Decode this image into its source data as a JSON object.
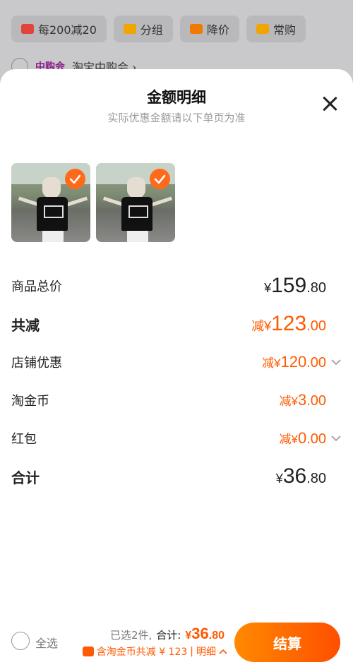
{
  "background": {
    "filters": [
      {
        "label": "每200减20",
        "icon": "shop-icon",
        "color": "#e0443a"
      },
      {
        "label": "分组",
        "icon": "folder-icon",
        "color": "#f0a500"
      },
      {
        "label": "降价",
        "icon": "down-arrow-icon",
        "color": "#f07a00"
      },
      {
        "label": "常购",
        "icon": "cart-icon",
        "color": "#f0a500"
      }
    ],
    "store_tag": "中购会",
    "store_name": "淘宝中购会 ›"
  },
  "sheet": {
    "title": "金额明细",
    "subtitle": "实际优惠金额请以下单页为准",
    "close_icon": "close-icon"
  },
  "items": [
    {
      "selected": true
    },
    {
      "selected": true
    }
  ],
  "breakdown": {
    "goods_total": {
      "label": "商品总价",
      "prefix": "¥",
      "int": "159",
      "dec": ".80"
    },
    "total_reduce": {
      "label": "共减",
      "prefix": "减¥",
      "int": "123",
      "dec": ".00"
    },
    "shop_discount": {
      "label": "店铺优惠",
      "prefix": "减¥",
      "int": "120",
      "dec": ".00"
    },
    "taojinbi": {
      "label": "淘金币",
      "prefix": "减¥",
      "int": "3",
      "dec": ".00"
    },
    "red_packet": {
      "label": "红包",
      "prefix": "减¥",
      "int": "0",
      "dec": ".00"
    },
    "sum": {
      "label": "合计",
      "prefix": "¥",
      "int": "36",
      "dec": ".80"
    }
  },
  "bottom_bar": {
    "select_all": "全选",
    "selected_count": "已选2件,",
    "total_label": "合计:",
    "total_prefix": "¥",
    "total_int": "36",
    "total_dec": ".80",
    "saving_text": "含淘金币共减 ¥ 123",
    "separator": "|",
    "detail_label": "明细",
    "checkout_label": "结算"
  },
  "colors": {
    "accent": "#ff5a00",
    "check": "#ff6a1a"
  }
}
